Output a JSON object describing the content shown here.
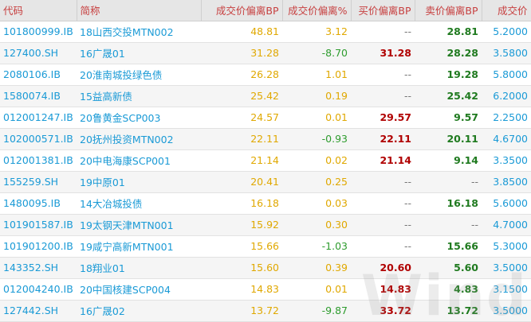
{
  "headers": [
    "代码",
    "简称",
    "成交价偏离BP",
    "成交价偏离%",
    "买价偏离BP",
    "卖价偏离BP",
    "成交价"
  ],
  "rows": [
    {
      "code": "101800999.IB",
      "name": "18山西交投MTN002",
      "trade_bp": "48.81",
      "trade_pct": "3.12",
      "buy_bp": "--",
      "sell_bp": "28.81",
      "price": "5.2000"
    },
    {
      "code": "127400.SH",
      "name": "16广晟01",
      "trade_bp": "31.28",
      "trade_pct": "-8.70",
      "buy_bp": "31.28",
      "sell_bp": "28.28",
      "price": "3.5800"
    },
    {
      "code": "2080106.IB",
      "name": "20淮南城投绿色债",
      "trade_bp": "26.28",
      "trade_pct": "1.01",
      "buy_bp": "--",
      "sell_bp": "19.28",
      "price": "5.8000"
    },
    {
      "code": "1580074.IB",
      "name": "15益高新债",
      "trade_bp": "25.42",
      "trade_pct": "0.19",
      "buy_bp": "--",
      "sell_bp": "25.42",
      "price": "6.2000"
    },
    {
      "code": "012001247.IB",
      "name": "20鲁黄金SCP003",
      "trade_bp": "24.57",
      "trade_pct": "0.01",
      "buy_bp": "29.57",
      "sell_bp": "9.57",
      "price": "2.2500"
    },
    {
      "code": "102000571.IB",
      "name": "20抚州投资MTN002",
      "trade_bp": "22.11",
      "trade_pct": "-0.93",
      "buy_bp": "22.11",
      "sell_bp": "20.11",
      "price": "4.6700"
    },
    {
      "code": "012001381.IB",
      "name": "20中电海康SCP001",
      "trade_bp": "21.14",
      "trade_pct": "0.02",
      "buy_bp": "21.14",
      "sell_bp": "9.14",
      "price": "3.3500"
    },
    {
      "code": "155259.SH",
      "name": "19中原01",
      "trade_bp": "20.41",
      "trade_pct": "0.25",
      "buy_bp": "--",
      "sell_bp": "--",
      "price": "3.8500"
    },
    {
      "code": "1480095.IB",
      "name": "14大冶城投债",
      "trade_bp": "16.18",
      "trade_pct": "0.03",
      "buy_bp": "--",
      "sell_bp": "16.18",
      "price": "5.6000"
    },
    {
      "code": "101901587.IB",
      "name": "19太钢天津MTN001",
      "trade_bp": "15.92",
      "trade_pct": "0.30",
      "buy_bp": "--",
      "sell_bp": "--",
      "price": "4.7000"
    },
    {
      "code": "101901200.IB",
      "name": "19咸宁高新MTN001",
      "trade_bp": "15.66",
      "trade_pct": "-1.03",
      "buy_bp": "--",
      "sell_bp": "15.66",
      "price": "5.3000"
    },
    {
      "code": "143352.SH",
      "name": "18翔业01",
      "trade_bp": "15.60",
      "trade_pct": "0.39",
      "buy_bp": "20.60",
      "sell_bp": "5.60",
      "price": "3.5000"
    },
    {
      "code": "012004240.IB",
      "name": "20中国核建SCP004",
      "trade_bp": "14.83",
      "trade_pct": "0.01",
      "buy_bp": "14.83",
      "sell_bp": "4.83",
      "price": "3.1500"
    },
    {
      "code": "127442.SH",
      "name": "16广晟02",
      "trade_bp": "13.72",
      "trade_pct": "-9.87",
      "buy_bp": "33.72",
      "sell_bp": "13.72",
      "price": "3.5000"
    }
  ],
  "watermark": "Wind",
  "colors": {
    "header_text": "#c74040",
    "code": "#1a9ad6",
    "trade_bp": "#e0a800",
    "buy": "#b00000",
    "sell": "#1f7a1f",
    "negative": "#2e9c2e"
  }
}
